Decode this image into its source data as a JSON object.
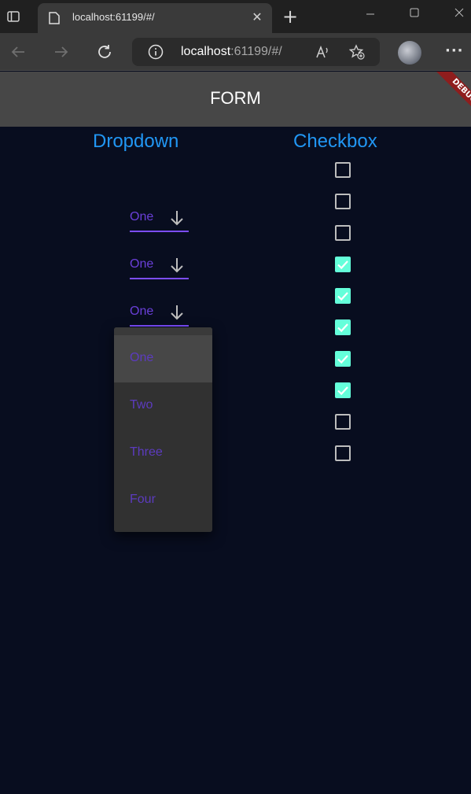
{
  "browser": {
    "tab_title": "localhost:61199/#/",
    "tab_close": "✕",
    "new_tab": "+",
    "address_host": "localhost",
    "address_rest": ":61199/#/",
    "more": "···",
    "icons": [
      "tab-actions-icon",
      "page-favicon-icon",
      "back-arrow-icon",
      "forward-arrow-icon",
      "refresh-icon",
      "info-icon",
      "read-aloud-icon",
      "add-favorite-icon",
      "more-icon"
    ]
  },
  "appbar": {
    "title": "FORM",
    "debug_label": "DEBUG"
  },
  "columns": {
    "dropdown_title": "Dropdown",
    "checkbox_title": "Checkbox"
  },
  "dropdowns": [
    {
      "value": "One"
    },
    {
      "value": "One"
    },
    {
      "value": "One"
    }
  ],
  "menu": {
    "options": [
      "One",
      "Two",
      "Three",
      "Four"
    ],
    "selected": "One"
  },
  "checkboxes": [
    false,
    false,
    false,
    true,
    true,
    true,
    true,
    true,
    false,
    false
  ],
  "colors": {
    "background": "#080d1f",
    "title_blue": "#2196f3",
    "dropdown_text": "#6a3fd9",
    "underline": "#7c4dff",
    "checkbox_on": "#64ffda",
    "appbar": "#474747",
    "debug_banner": "#8f1d1d"
  }
}
